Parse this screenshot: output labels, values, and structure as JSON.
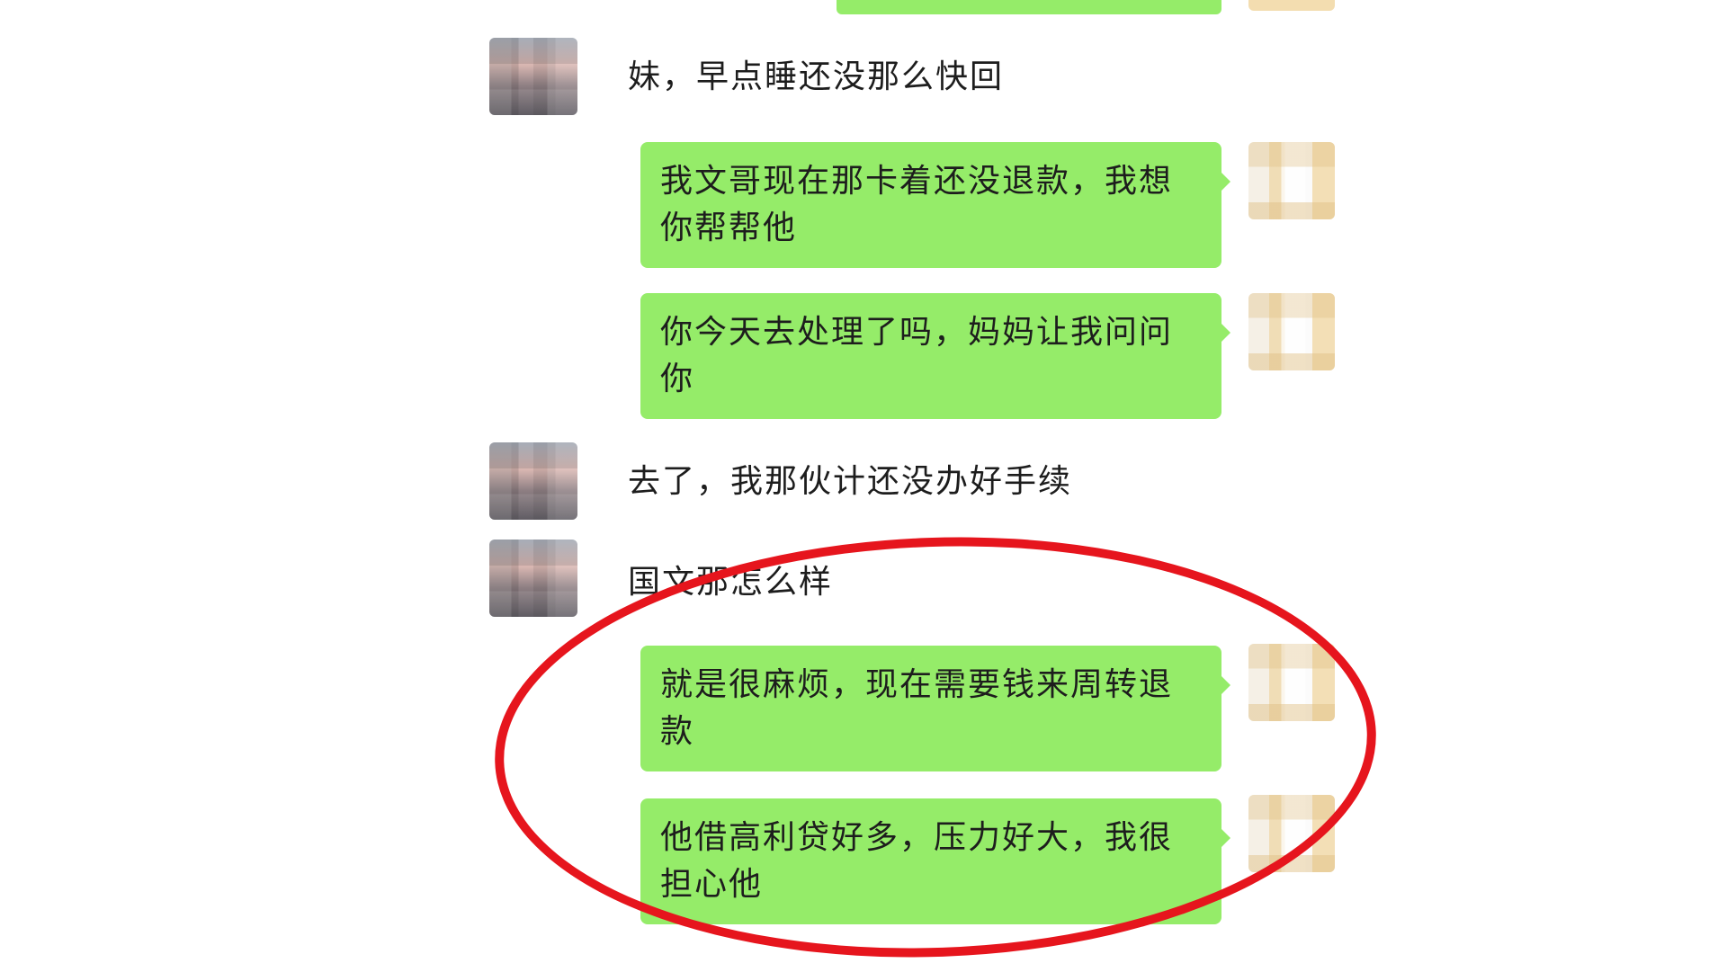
{
  "messages": [
    {
      "side": "left",
      "text": "妹，早点睡还没那么快回"
    },
    {
      "side": "right",
      "text": "我文哥现在那卡着还没退款，我想你帮帮他"
    },
    {
      "side": "right",
      "text": "你今天去处理了吗，妈妈让我问问你"
    },
    {
      "side": "left",
      "text": "去了，我那伙计还没办好手续"
    },
    {
      "side": "left",
      "text": "国文那怎么样"
    },
    {
      "side": "right",
      "text": "就是很麻烦，现在需要钱来周转退款"
    },
    {
      "side": "right",
      "text": "他借高利贷好多，压力好大，我很担心他"
    }
  ],
  "colors": {
    "bubble_green": "#95ec69",
    "annotation_red": "#e6151d",
    "text": "#1d1d1d"
  }
}
